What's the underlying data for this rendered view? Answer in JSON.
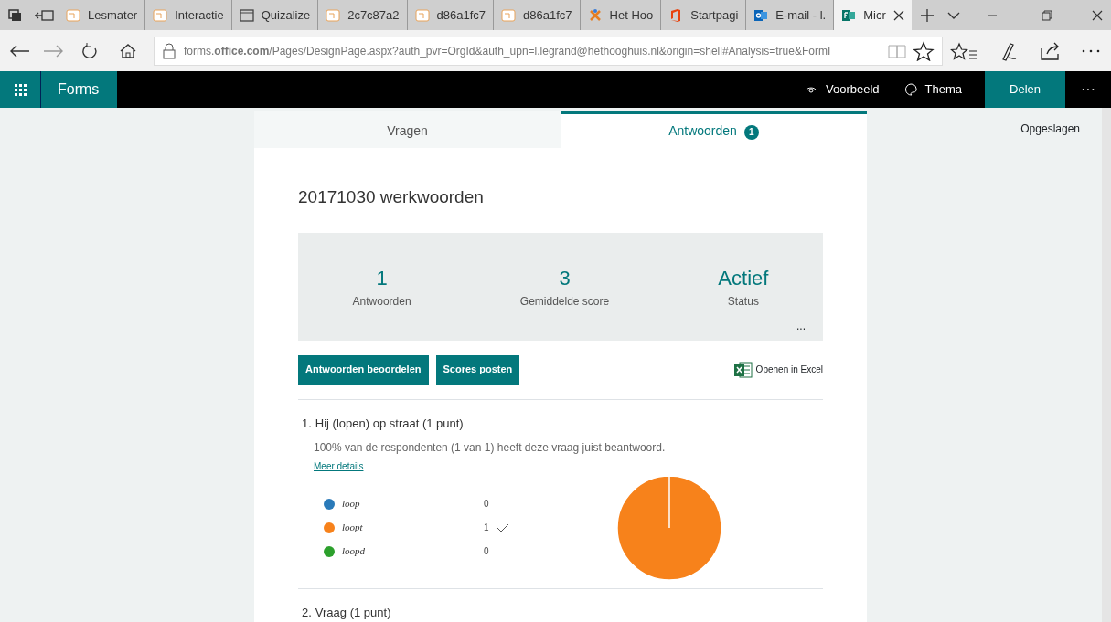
{
  "browser": {
    "tabs": [
      {
        "kind": "page",
        "label": "Lesmater",
        "selected": false
      },
      {
        "kind": "page",
        "label": "Interactie",
        "selected": false
      },
      {
        "kind": "window",
        "label": "Quizalize",
        "selected": false
      },
      {
        "kind": "page",
        "label": "2c7c87a2",
        "selected": false
      },
      {
        "kind": "page",
        "label": "d86a1fc7",
        "selected": false
      },
      {
        "kind": "page",
        "label": "d86a1fc7",
        "selected": false
      },
      {
        "kind": "spark",
        "label": "Het Hoo",
        "selected": false
      },
      {
        "kind": "office",
        "label": "Startpagi",
        "selected": false
      },
      {
        "kind": "outlook",
        "label": "E-mail - l.",
        "selected": false
      },
      {
        "kind": "forms",
        "label": "Micr",
        "selected": true
      }
    ],
    "address": "forms.**office.com**/Pages/DesignPage.aspx?auth_pvr=OrgId&auth_upn=l.legrand@hethooghuis.nl&origin=shell#Analysis=true&FormI"
  },
  "app_bar": {
    "title": "Forms",
    "actions": [
      {
        "kind": "eye",
        "label": "Voorbeeld"
      },
      {
        "kind": "palette",
        "label": "Thema"
      }
    ],
    "share": "Delen",
    "more": "···"
  },
  "status": "Opgeslagen",
  "form_tabs": [
    {
      "label": "Vragen",
      "selected": false
    },
    {
      "label": "Antwoorden",
      "selected": true,
      "badge": "1"
    }
  ],
  "form_title": "20171030 werkwoorden",
  "stats": [
    {
      "value": "1",
      "label": "Antwoorden"
    },
    {
      "value": "3",
      "label": "Gemiddelde score"
    },
    {
      "value": "Actief",
      "label": "Status"
    }
  ],
  "stats_more": "...",
  "buttons": [
    "Antwoorden beoordelen",
    "Scores posten"
  ],
  "excel_link": "Openen in Excel",
  "questions": [
    {
      "number": "1.",
      "title": "Hij (lopen) op straat (1 punt)",
      "summary": "100% van de respondenten (1 van 1) heeft deze vraag juist beantwoord.",
      "details_link": "Meer details",
      "answers": [
        {
          "count": "0",
          "color": "#2a7ab9",
          "correct": false
        },
        {
          "count": "1",
          "color": "#f7821b",
          "correct": true
        },
        {
          "count": "0",
          "color": "#2ca02c",
          "correct": false
        }
      ],
      "chart_data": {
        "type": "pie",
        "categories": [
          "loop",
          "loopt",
          "loopd"
        ],
        "values": [
          0,
          1,
          0
        ]
      }
    },
    {
      "number": "2.",
      "title": "Vraag (1 punt)"
    }
  ]
}
